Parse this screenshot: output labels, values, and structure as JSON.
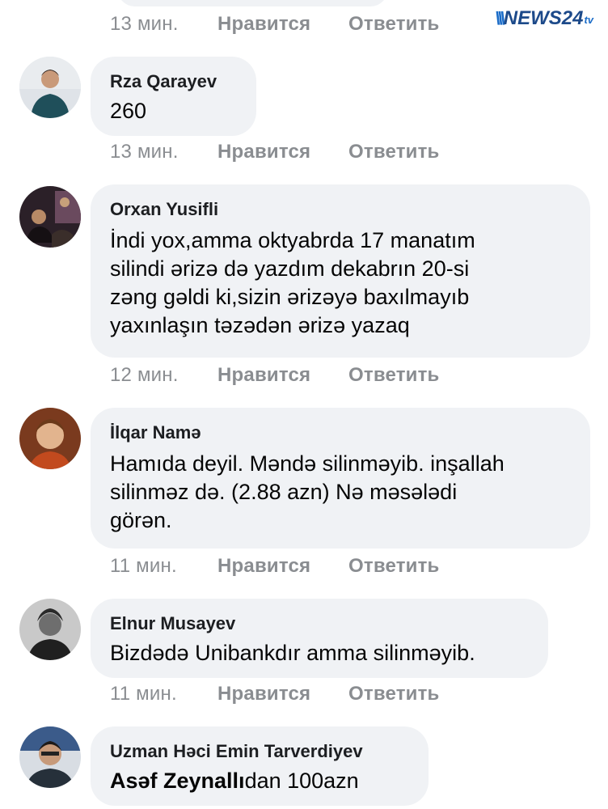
{
  "watermark": {
    "name": "NEWS24",
    "suffix": "tv"
  },
  "top_actions": {
    "time": "13 мин.",
    "like": "Нравится",
    "reply": "Ответить"
  },
  "comments": [
    {
      "author": "Rza Qarayev",
      "text": "260",
      "time": "13 мин.",
      "like": "Нравится",
      "reply": "Ответить"
    },
    {
      "author": "Orxan Yusifli",
      "lines": [
        "İndi yox,amma oktyabrda 17 manatım",
        "silindi ərizə də yazdım dekabrın 20-si",
        "zəng gəldi ki,sizin ərizəyə baxılmayıb",
        "yaxınlaşın təzədən ərizə yazaq"
      ],
      "time": "12 мин.",
      "like": "Нравится",
      "reply": "Ответить"
    },
    {
      "author": "İlqar Namə",
      "lines": [
        "Hamıda deyil. Məndə silinməyib. inşallah",
        "silinməz də. (2.88 azn) Nə məsələdi",
        "görən."
      ],
      "time": "11 мин.",
      "like": "Нравится",
      "reply": "Ответить"
    },
    {
      "author": "Elnur Musayev",
      "text": "Bizdədə Unibankdır amma silinməyib.",
      "time": "11 мин.",
      "like": "Нравится",
      "reply": "Ответить"
    },
    {
      "author": "Uzman Həci Emin Tarverdiyev",
      "tag": "Asəf Zeynallı",
      "text_after_tag": "dan 100azn"
    }
  ]
}
